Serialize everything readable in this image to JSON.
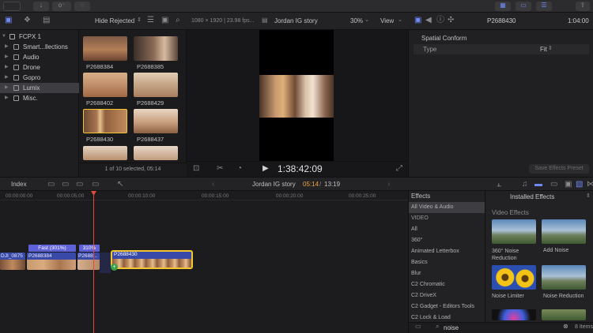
{
  "toolbar": {
    "right_clip_name": "P2688430",
    "timecode_right": "1:04:00"
  },
  "browser": {
    "filter": "Hide Rejected",
    "status": "1 of 10 selected, 05:14",
    "clips": [
      "P2688384",
      "P2688385",
      "P2688402",
      "P2688429",
      "P2688430",
      "P2688437"
    ]
  },
  "library": {
    "name": "FCPX 1",
    "items": [
      "Smart...llections",
      "Audio",
      "Drone",
      "Gopro",
      "Lumix",
      "Misc."
    ]
  },
  "viewer": {
    "format": "1080 × 1920 | 23.98 fps...",
    "project": "Jordan IG story",
    "zoom": "30%",
    "view_label": "View",
    "timecode": "1:38:42:09"
  },
  "inspector": {
    "clip_name": "P2688430",
    "timecode": "1:04:00",
    "section": "Spatial Conform",
    "type_label": "Type",
    "type_value": "Fit",
    "save_button": "Save Effects Preset"
  },
  "timeline": {
    "index_label": "Index",
    "project": "Jordan IG story",
    "position": "05:14",
    "duration": "13:19",
    "ruler": [
      "00:00:00:00",
      "00:00:05:00",
      "00:00:10:00",
      "00:00:15:00",
      "00:00:20:00",
      "00:00:25:00"
    ],
    "speed_labels": [
      "Fast (301%)",
      "310%"
    ],
    "clips": [
      "DJI_0875",
      "P2688384",
      "P2688...",
      "P2688430"
    ]
  },
  "effects": {
    "title": "Effects",
    "installed": "Installed Effects",
    "categories": [
      "All Video & Audio",
      "VIDEO",
      "All",
      "360°",
      "Animated Letterbox",
      "Basics",
      "Blur",
      "C2 Chromatic",
      "C2 DriveX",
      "C2 Gadget - Editors Tools",
      "C2 Lock & Load"
    ],
    "section_heading": "Video Effects",
    "items": [
      "360° Noise Reduction",
      "Add Noise",
      "Noise Limiter",
      "Noise Reduction"
    ],
    "search_value": "noise",
    "count": "8 Items"
  },
  "colors": {
    "accent": "#4f6bf5",
    "selection": "#f2c531",
    "playhead": "#e04b3c",
    "position_orange": "#f0a73a"
  }
}
